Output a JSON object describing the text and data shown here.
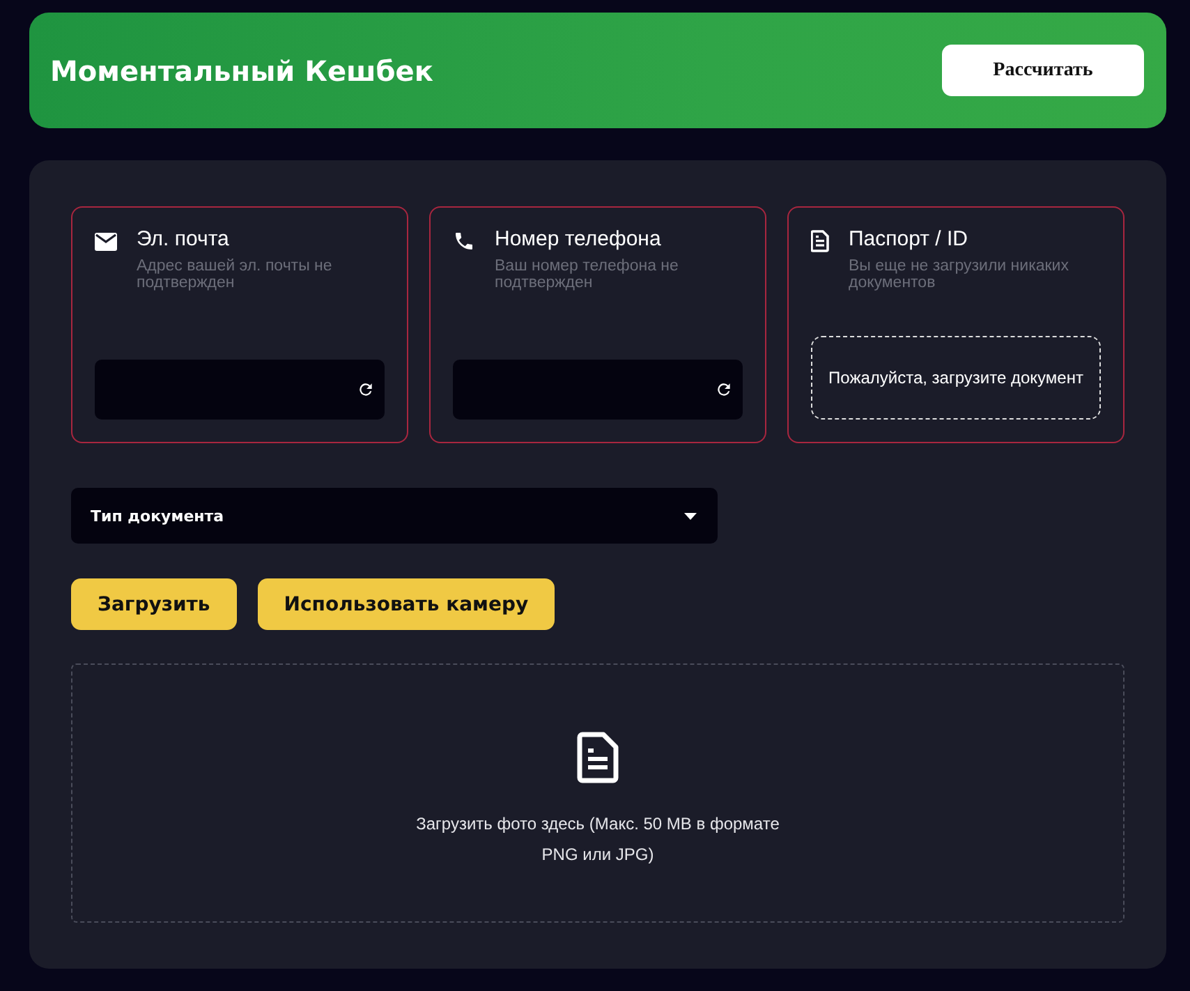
{
  "header": {
    "title": "Моментальный Кешбек",
    "button": "Рассчитать"
  },
  "cards": [
    {
      "kind": "email",
      "title": "Эл. почта",
      "subtitle": "Адрес вашей эл. почты не подтвержден"
    },
    {
      "kind": "phone",
      "title": "Номер телефона",
      "subtitle": "Ваш номер телефона не подтвержден"
    },
    {
      "kind": "document",
      "title": "Паспорт / ID",
      "subtitle": "Вы еще не загрузили никаких документов",
      "prompt": "Пожалуйста, загрузите документ"
    }
  ],
  "document_type": {
    "placeholder": "Тип документа"
  },
  "buttons": [
    "Загрузить",
    "Использовать камеру"
  ],
  "upload": {
    "text": "Загрузить фото здесь (Макс. 50 MB в формате PNG или JPG)"
  }
}
